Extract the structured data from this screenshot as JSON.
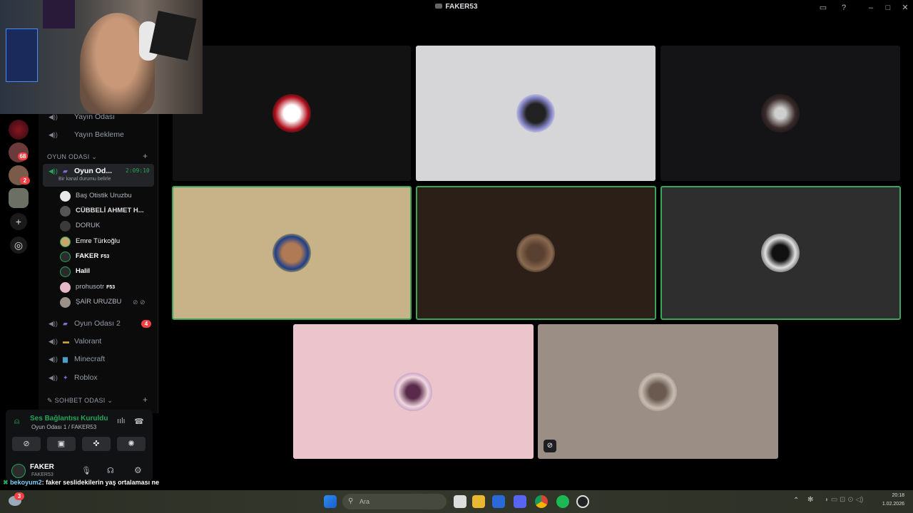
{
  "window": {
    "title": "FAKER53"
  },
  "rail": {
    "badges": [
      "68",
      "2"
    ]
  },
  "channels": {
    "top_items": [
      "Yayın Odası",
      "Yayın Bekleme"
    ],
    "category_game": "OYUN ODASI",
    "active_channel": {
      "label": "Oyun Od...",
      "timer": "2:09:10",
      "status": "Bir kanal durumu belirle"
    },
    "members": [
      {
        "name": "Baş Otistik Uruzbu",
        "tag": ""
      },
      {
        "name": "CÜBBELİ AHMET H...",
        "tag": ""
      },
      {
        "name": "DORUK",
        "tag": ""
      },
      {
        "name": "Emre Türkoğlu",
        "tag": ""
      },
      {
        "name": "FAKER",
        "tag": "F53"
      },
      {
        "name": "Halil",
        "tag": ""
      },
      {
        "name": "prohusotr",
        "tag": "F53"
      },
      {
        "name": "ŞAİR URUZBU",
        "tag": ""
      }
    ],
    "other_channels": [
      {
        "label": "Oyun Odası 2",
        "badge": "4"
      },
      {
        "label": "Valorant",
        "badge": ""
      },
      {
        "label": "Minecraft",
        "badge": ""
      },
      {
        "label": "Roblox",
        "badge": ""
      }
    ],
    "category_chat": "SOHBET ODASI"
  },
  "voice_panel": {
    "status": "Ses Bağlantısı Kuruldu",
    "channel": "Oyun Odası 1 / FAKER53",
    "user_name": "FAKER",
    "user_tag": "FAKER53"
  },
  "chat_overlay": {
    "user": "bekoyum2",
    "message": ": faker seslidekilerin yaş ortalaması ne"
  },
  "taskbar": {
    "search_placeholder": "Ara",
    "badge": "3",
    "time": "20:18",
    "date": "1.02.2026"
  },
  "colors": {
    "speaking_border": "#3ba55d",
    "voice_connected": "#23a55a",
    "notification_red": "#f23f43"
  }
}
